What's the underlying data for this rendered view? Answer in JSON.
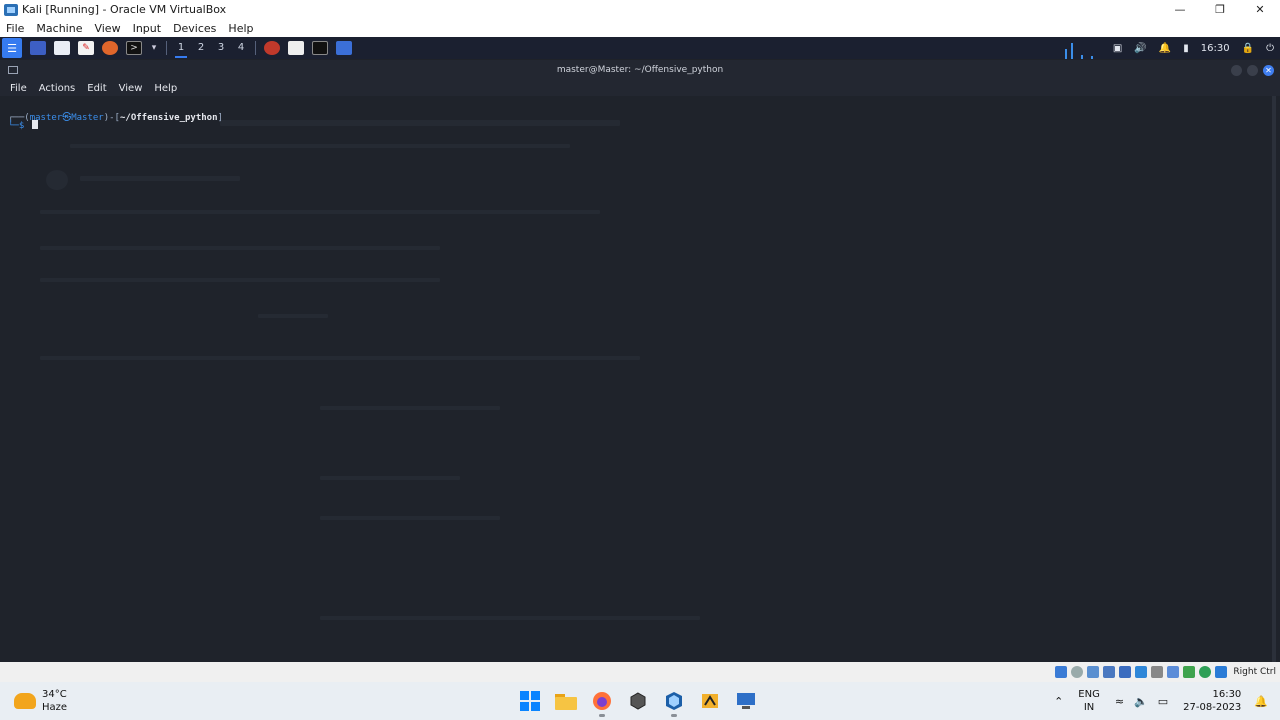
{
  "window": {
    "title": "Kali [Running] - Oracle VM VirtualBox"
  },
  "vbox_menu": [
    "File",
    "Machine",
    "View",
    "Input",
    "Devices",
    "Help"
  ],
  "kali_panel": {
    "workspaces": [
      "1",
      "2",
      "3",
      "4"
    ],
    "active_workspace": 0,
    "clock": "16:30"
  },
  "terminal": {
    "title": "master@Master: ~/Offensive_python",
    "menu": [
      "File",
      "Actions",
      "Edit",
      "View",
      "Help"
    ],
    "prompt": {
      "user_host": "master㉿Master",
      "path": "~/Offensive_python",
      "symbol": "$"
    }
  },
  "vbox_status": {
    "host_key": "Right Ctrl"
  },
  "taskbar": {
    "weather": {
      "temp": "34°C",
      "condition": "Haze"
    },
    "lang": {
      "primary": "ENG",
      "secondary": "IN"
    },
    "clock": {
      "time": "16:30",
      "date": "27-08-2023"
    }
  },
  "colors": {
    "kali_accent": "#367bf0",
    "terminal_bg": "#1f232b"
  }
}
